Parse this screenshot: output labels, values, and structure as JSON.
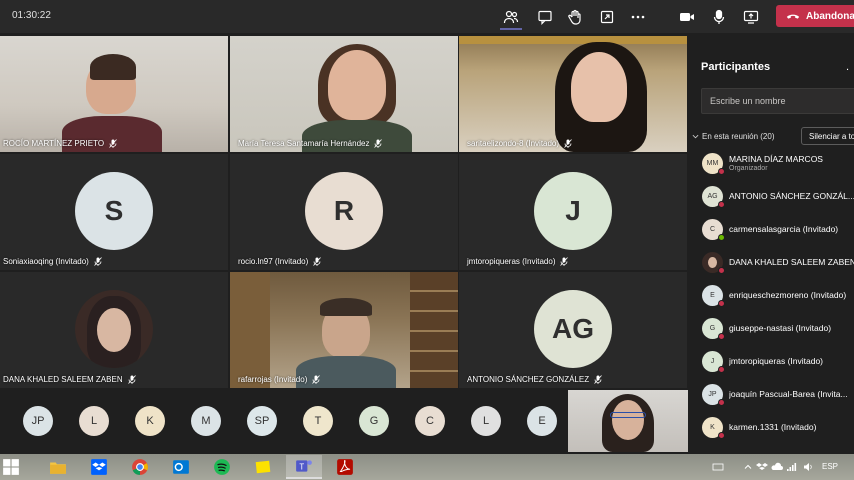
{
  "meeting": {
    "timer": "01:30:22",
    "leave_label": "Abandonar"
  },
  "toolbar": {
    "icons": [
      "participants-icon",
      "chat-icon",
      "raise-hand-icon",
      "share-tray-icon",
      "more-options-icon",
      "camera-icon",
      "microphone-icon",
      "share-screen-icon"
    ]
  },
  "tiles": [
    {
      "name": "ROCÍO MARTÍNEZ PRIETO",
      "type": "video"
    },
    {
      "name": "María Teresa Santamaría Hernández",
      "type": "video"
    },
    {
      "name": "saritaelizondo-8 (Invitado)",
      "type": "video"
    },
    {
      "name": "Soniaxiaoqing (Invitado)",
      "initials": "S",
      "type": "avatar"
    },
    {
      "name": "rocio.ln97 (Invitado)",
      "initials": "R",
      "type": "avatar"
    },
    {
      "name": "jmtoropiqueras (Invitado)",
      "initials": "J",
      "type": "avatar"
    },
    {
      "name": "DANA KHALED SALEEM ZABEN",
      "type": "photo"
    },
    {
      "name": "rafarrojas (Invitado)",
      "type": "video"
    },
    {
      "name": "ANTONIO SÁNCHEZ GONZÁLEZ",
      "initials": "AG",
      "type": "avatar"
    }
  ],
  "strip": [
    "JP",
    "L",
    "K",
    "M",
    "SP",
    "T",
    "G",
    "C",
    "L",
    "E"
  ],
  "panel": {
    "title": "Participantes",
    "close": ".",
    "search_placeholder": "Escribe un nombre",
    "section_label": "En esta reunión (20)",
    "mute_all_label": "Silenciar a todos",
    "participants": [
      {
        "initials": "MM",
        "name": "MARINA DÍAZ MARCOS",
        "sub": "Organizador",
        "status": "red"
      },
      {
        "initials": "AG",
        "name": "ANTONIO SÁNCHEZ GONZÁL...",
        "sub": "",
        "status": "red"
      },
      {
        "initials": "C",
        "name": "carmensalasgarcia (Invitado)",
        "sub": "",
        "status": "green"
      },
      {
        "initials": "",
        "name": "DANA KHALED SALEEM ZABEN",
        "sub": "",
        "status": "red"
      },
      {
        "initials": "E",
        "name": "enriqueschezmoreno (Invitado)",
        "sub": "",
        "status": "red"
      },
      {
        "initials": "G",
        "name": "giuseppe-nastasi (Invitado)",
        "sub": "",
        "status": "red"
      },
      {
        "initials": "J",
        "name": "jmtoropiqueras (Invitado)",
        "sub": "",
        "status": "red"
      },
      {
        "initials": "JP",
        "name": "joaquín Pascual-Barea (Invita...",
        "sub": "",
        "status": "red"
      },
      {
        "initials": "K",
        "name": "karmen.1331 (Invitado)",
        "sub": "",
        "status": "red"
      }
    ]
  },
  "taskbar": {
    "apps": [
      "windows-start-icon",
      "file-explorer-icon",
      "dropbox-icon",
      "chrome-icon",
      "outlook-icon",
      "spotify-icon",
      "sticky-notes-icon",
      "teams-icon",
      "acrobat-icon"
    ],
    "language": "ESP"
  },
  "colors": {
    "accent": "#6264a7",
    "leave": "#c4314b",
    "avatar_bg": "#d9e6d4"
  }
}
